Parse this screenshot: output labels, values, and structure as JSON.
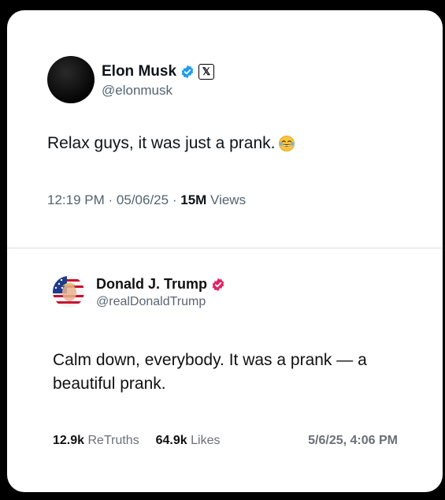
{
  "tweet": {
    "name": "Elon Musk",
    "handle": "@elonmusk",
    "text": "Relax guys, it was just a prank.",
    "time": "12:19 PM",
    "date": "05/06/25",
    "sep": "·",
    "views_count": "15M",
    "views_label": "Views",
    "x_logo": "𝕏"
  },
  "truth": {
    "name": "Donald J. Trump",
    "handle": "@realDonaldTrump",
    "text": "Calm down, everybody. It was a prank — a beautiful prank.",
    "retruths_count": "12.9k",
    "retruths_label": "ReTruths",
    "likes_count": "64.9k",
    "likes_label": "Likes",
    "datetime": "5/6/25, 4:06 PM"
  },
  "colors": {
    "x_verified": "#1d9bf0",
    "truth_verified": "#e0245e"
  },
  "icons": [
    "x-verified-icon",
    "x-logo-icon",
    "laughing-emoji-icon",
    "truth-verified-icon"
  ]
}
